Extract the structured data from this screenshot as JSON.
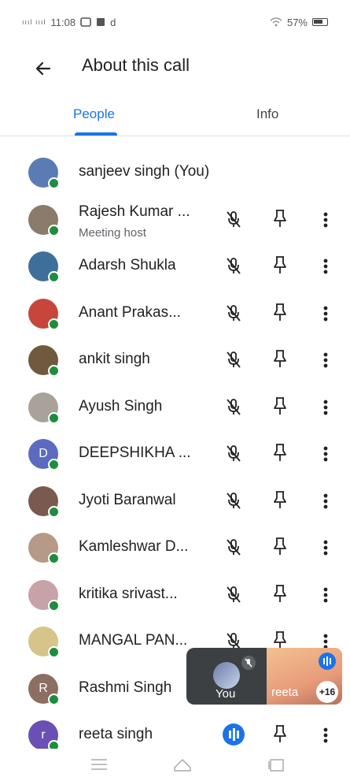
{
  "status_bar": {
    "signal": "ıııl ıııl",
    "time": "11:08",
    "notif": "d",
    "wifi": "⟟",
    "battery": "57%"
  },
  "header": {
    "back_icon": "arrow-left",
    "title": "About this call"
  },
  "tabs": [
    {
      "label": "People",
      "active": true
    },
    {
      "label": "Info",
      "active": false
    }
  ],
  "participants": [
    {
      "name": "sanjeev singh (You)",
      "subtitle": "",
      "avatar_color": "#5b7bb5",
      "initial": "",
      "controls": false
    },
    {
      "name": "Rajesh Kumar ...",
      "subtitle": "Meeting host",
      "avatar_color": "#8a7b6a",
      "initial": "",
      "controls": true
    },
    {
      "name": "Adarsh Shukla",
      "subtitle": "",
      "avatar_color": "#3e6f9a",
      "initial": "",
      "controls": true
    },
    {
      "name": "Anant Prakas...",
      "subtitle": "",
      "avatar_color": "#c8453b",
      "initial": "",
      "controls": true
    },
    {
      "name": "ankit singh",
      "subtitle": "",
      "avatar_color": "#6f5a3e",
      "initial": "",
      "controls": true
    },
    {
      "name": "Ayush Singh",
      "subtitle": "",
      "avatar_color": "#a8a29a",
      "initial": "",
      "controls": true
    },
    {
      "name": "DEEPSHIKHA ...",
      "subtitle": "",
      "avatar_color": "#5c6bc0",
      "initial": "D",
      "controls": true
    },
    {
      "name": "Jyoti Baranwal",
      "subtitle": "",
      "avatar_color": "#7a5a4e",
      "initial": "",
      "controls": true
    },
    {
      "name": "Kamleshwar D...",
      "subtitle": "",
      "avatar_color": "#b59a88",
      "initial": "",
      "controls": true
    },
    {
      "name": "kritika srivast...",
      "subtitle": "",
      "avatar_color": "#c7a2a8",
      "initial": "",
      "controls": true
    },
    {
      "name": "MANGAL PAN...",
      "subtitle": "",
      "avatar_color": "#d6c48a",
      "initial": "",
      "controls": true
    },
    {
      "name": "Rashmi Singh",
      "subtitle": "",
      "avatar_color": "#8d6e63",
      "initial": "R",
      "controls": false
    },
    {
      "name": "reeta singh",
      "subtitle": "",
      "avatar_color": "#6a4fb5",
      "initial": "r",
      "controls": true,
      "speaking": true
    }
  ],
  "pip": {
    "self_label": "You",
    "other_label": "reeta",
    "extra_count": "+16"
  },
  "colors": {
    "accent": "#1a73e8",
    "online": "#1e8e3e",
    "pip_bg": "#3c4043"
  }
}
